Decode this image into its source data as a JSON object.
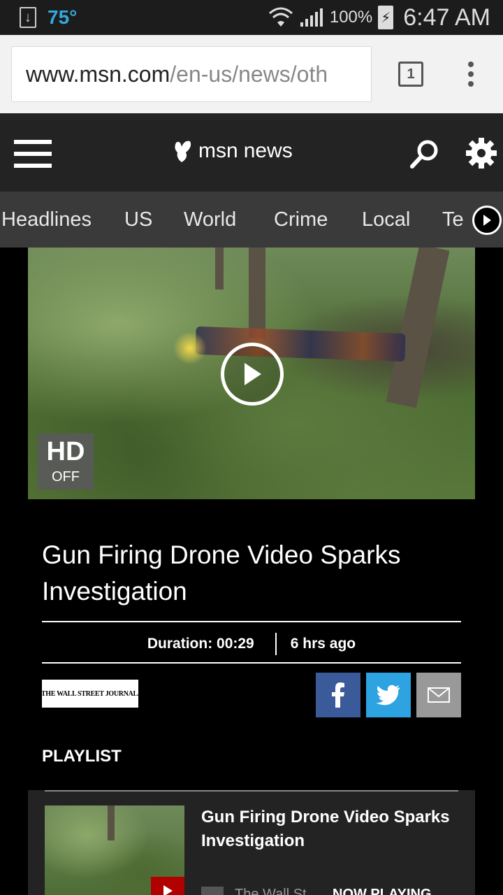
{
  "status_bar": {
    "temperature": "75°",
    "battery": "100%",
    "time": "6:47 AM"
  },
  "browser": {
    "url_host": "www.msn.com",
    "url_path": "/en-us/news/oth",
    "tab_count": "1"
  },
  "header": {
    "brand_msn": "msn",
    "brand_section": "news"
  },
  "nav": {
    "items": [
      "Headlines",
      "US",
      "World",
      "Crime",
      "Local",
      "Te"
    ]
  },
  "video": {
    "hd_label": "HD",
    "hd_state": "OFF"
  },
  "article": {
    "title": "Gun Firing Drone Video Sparks Investigation",
    "duration": "Duration: 00:29",
    "age": "6 hrs ago",
    "source": "THE WALL STREET JOURNAL."
  },
  "playlist": {
    "heading": "PLAYLIST",
    "items": [
      {
        "title": "Gun Firing Drone Video Sparks Investigation",
        "source": "The Wall St...",
        "status": "NOW PLAYING"
      }
    ]
  },
  "colors": {
    "facebook": "#3b5a9a",
    "twitter": "#2ea3e2",
    "mail": "#999999",
    "temperature": "#33a9dc"
  }
}
